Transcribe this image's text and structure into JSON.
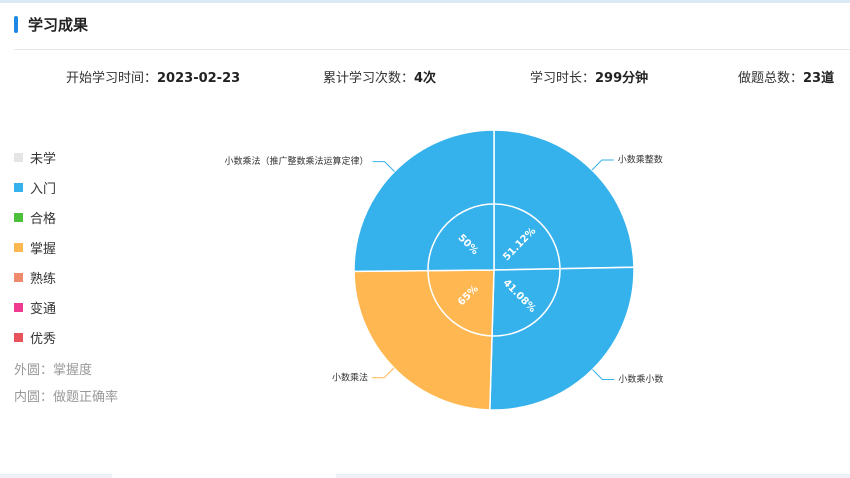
{
  "header": {
    "title": "学习成果"
  },
  "stats": [
    {
      "label": "开始学习时间：",
      "value": "2023-02-23"
    },
    {
      "label": "累计学习次数：",
      "value": "4次"
    },
    {
      "label": "学习时长：",
      "value": "299分钟"
    },
    {
      "label": "做题总数：",
      "value": "23道"
    }
  ],
  "legend": [
    {
      "label": "未学",
      "color": "#e5e5e5"
    },
    {
      "label": "入门",
      "color": "#35b1ec"
    },
    {
      "label": "合格",
      "color": "#4cc03b"
    },
    {
      "label": "掌握",
      "color": "#ffb751"
    },
    {
      "label": "熟练",
      "color": "#f08a6c"
    },
    {
      "label": "变通",
      "color": "#ee3b8f"
    },
    {
      "label": "优秀",
      "color": "#e8525a"
    }
  ],
  "notes": {
    "outer": "外圆：掌握度",
    "inner": "内圆：做题正确率"
  },
  "chart_data": {
    "type": "pie",
    "categories": [
      "小数乘整数",
      "小数乘小数",
      "小数乘法",
      "小数乘法（推广整数乘法运算定律）"
    ],
    "outer_mastery": [
      "入门",
      "入门",
      "掌握",
      "入门"
    ],
    "outer_colors": [
      "#35b1ec",
      "#35b1ec",
      "#ffb751",
      "#35b1ec"
    ],
    "inner_accuracy": [
      "51.12%",
      "41.08%",
      "65%",
      "50%"
    ],
    "inner_values": [
      51.12,
      41.08,
      65,
      50
    ],
    "legend_position": "left"
  }
}
